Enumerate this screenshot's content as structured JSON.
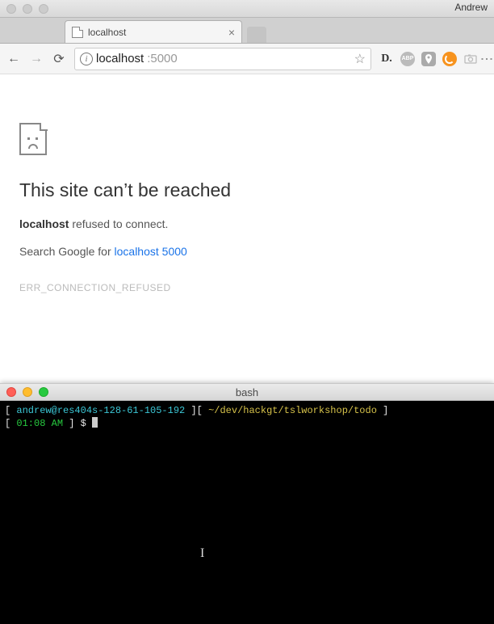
{
  "mac": {
    "profile_name": "Andrew"
  },
  "browser": {
    "tab": {
      "title": "localhost",
      "close_glyph": "×"
    },
    "nav": {
      "back_glyph": "←",
      "forward_glyph": "→",
      "reload_glyph": "⟳"
    },
    "omnibox": {
      "info_glyph": "i",
      "url_host": "localhost",
      "url_port": ":5000",
      "star_glyph": "☆"
    },
    "extensions": {
      "d_label": "D.",
      "abp_label": "ABP",
      "menu_glyph": "⋮"
    }
  },
  "error": {
    "heading": "This site can’t be reached",
    "host_bold": "localhost",
    "refused_text": " refused to connect.",
    "search_prefix": "Search Google for ",
    "search_link": "localhost 5000",
    "code": "ERR_CONNECTION_REFUSED"
  },
  "terminal": {
    "title": "bash",
    "line1": {
      "lb1": "[ ",
      "userhost": "andrew@res404s-128-61-105-192",
      "mid": " ][ ",
      "path": "~/dev/hackgt/tslworkshop/todo",
      "rb1": " ]"
    },
    "line2": {
      "lb1": "[ ",
      "time": "01:08 AM",
      "rb1": " ] ",
      "prompt": "$ "
    },
    "ibeam_glyph": "I"
  }
}
